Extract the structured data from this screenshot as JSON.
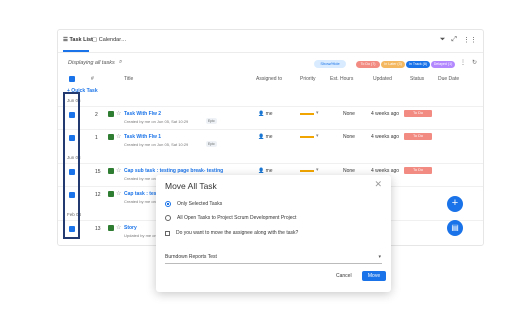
{
  "tabs": [
    {
      "label": "☰ Task List",
      "active": true
    },
    {
      "label": "▢ Calendar",
      "active": false
    },
    {
      "label": "…",
      "active": false
    }
  ],
  "top_icons": [
    "filter-icon",
    "expand-icon",
    "grid-icon"
  ],
  "displaying": "Displaying all tasks",
  "show_hide": "Show/Hide",
  "status_pills": [
    {
      "label": "To Do (7)",
      "color": "#f28b82"
    },
    {
      "label": "In Later (3)",
      "color": "#f4b860"
    },
    {
      "label": "In Track (8)",
      "color": "#1a73e8"
    },
    {
      "label": "Delayed (1)",
      "color": "#b388ff"
    }
  ],
  "columns": {
    "num": "#",
    "title": "Title",
    "assigned": "Assigned to",
    "priority": "Priority",
    "hours": "Est. Hours",
    "updated": "Updated",
    "status": "Status",
    "due": "Due Date"
  },
  "quick_task": "+ Quick Task",
  "groups": [
    {
      "label": "Jun 05"
    },
    {
      "label": "Jun 03"
    },
    {
      "label": "Feb 04"
    }
  ],
  "rows": [
    {
      "num": "2",
      "title": "Task With Flw 2",
      "created": "Created by me on Jun 05, Sat 10:29",
      "tag": "Epic",
      "assignee": "me",
      "hours": "None",
      "updated": "4 weeks ago",
      "status": "To Do"
    },
    {
      "num": "1",
      "title": "Task With Flw 1",
      "created": "Created by me on Jun 05, Sat 10:29",
      "tag": "Epic",
      "assignee": "me",
      "hours": "None",
      "updated": "4 weeks ago",
      "status": "To Do"
    },
    {
      "num": "15",
      "title": "Cap sub task : testing page break- testing",
      "created": "Created by me on ...",
      "tag": "",
      "assignee": "me",
      "hours": "None",
      "updated": "4 weeks ago",
      "status": "To Do"
    },
    {
      "num": "12",
      "title": "Cap task : testi",
      "created": "Created by me on ...",
      "tag": "",
      "assignee": "me",
      "hours": "None",
      "updated": "4 weeks ago",
      "status": "To Do"
    },
    {
      "num": "13",
      "title": "Story",
      "created": "Updated by me on ...",
      "tag": "",
      "assignee": "me",
      "hours": "None",
      "updated": "4 weeks ago",
      "status": "To Do"
    }
  ],
  "modal": {
    "title": "Move All Task",
    "option1": "Only Selected Tasks",
    "option2": "All Open Tasks to Project Scrum Development Project",
    "option3": "Do you want to move the assignee along with the task?",
    "dropdown": "Burndown Reports Test",
    "cancel": "Cancel",
    "move": "Move"
  },
  "colors": {
    "accent": "#1a73e8",
    "status_todo": "#f28b82",
    "priority": "#f0a500"
  }
}
